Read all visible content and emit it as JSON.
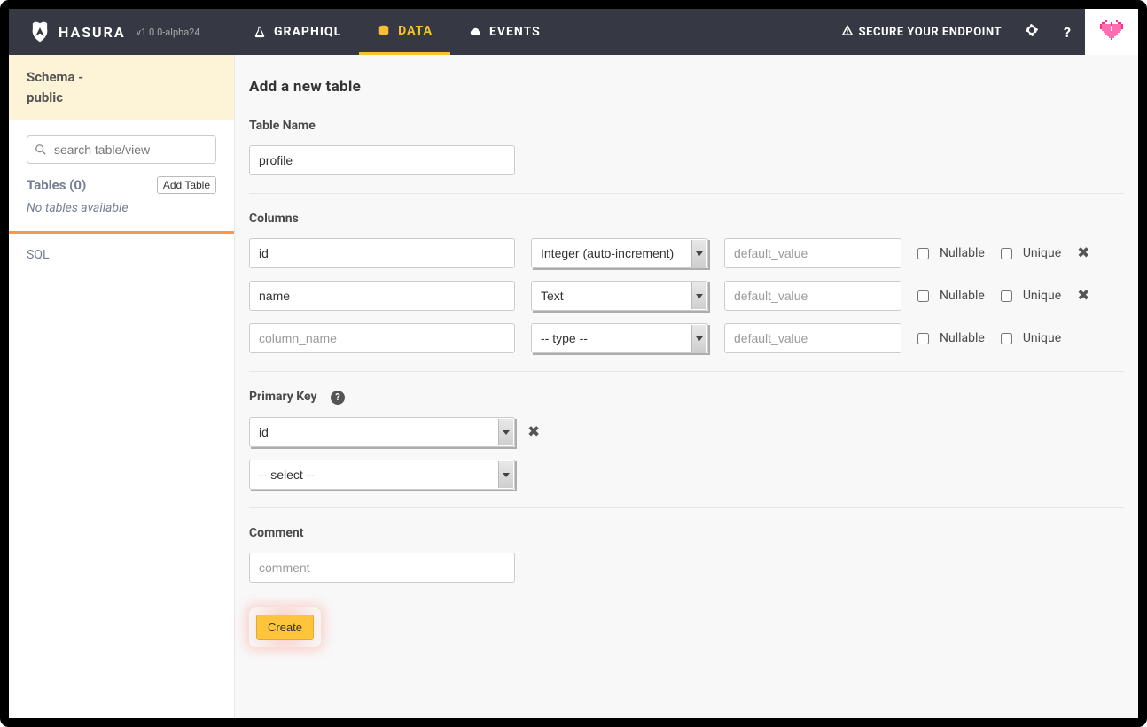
{
  "header": {
    "brand": "HASURA",
    "version": "v1.0.0-alpha24",
    "nav": {
      "graphiql": "GRAPHIQL",
      "data": "DATA",
      "events": "EVENTS"
    },
    "secure": "SECURE YOUR ENDPOINT"
  },
  "sidebar": {
    "schema_label": "Schema -",
    "schema_name": "public",
    "search_placeholder": "search table/view",
    "tables_label": "Tables (0)",
    "add_table": "Add Table",
    "no_tables": "No tables available",
    "sql": "SQL"
  },
  "page": {
    "title": "Add a new table",
    "table_name_label": "Table Name",
    "table_name_value": "profile",
    "columns_label": "Columns",
    "columns": [
      {
        "name": "id",
        "type": "Integer (auto-increment)",
        "default_ph": "default_value",
        "nullable_label": "Nullable",
        "unique_label": "Unique",
        "removable": true
      },
      {
        "name": "name",
        "type": "Text",
        "default_ph": "default_value",
        "nullable_label": "Nullable",
        "unique_label": "Unique",
        "removable": true
      },
      {
        "name": "",
        "name_ph": "column_name",
        "type": "-- type --",
        "default_ph": "default_value",
        "nullable_label": "Nullable",
        "unique_label": "Unique",
        "removable": false
      }
    ],
    "pk_label": "Primary Key",
    "pk_options": [
      "id",
      "-- select --"
    ],
    "comment_label": "Comment",
    "comment_ph": "comment",
    "create_btn": "Create"
  }
}
